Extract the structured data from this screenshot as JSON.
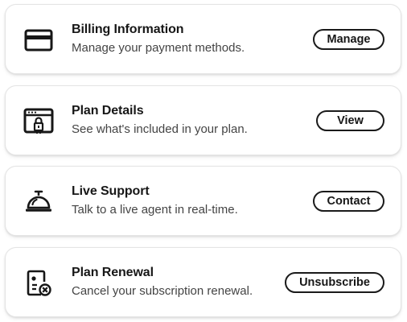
{
  "cards": [
    {
      "icon": "credit-card-icon",
      "title": "Billing Information",
      "subtitle": "Manage your payment methods.",
      "button": "Manage"
    },
    {
      "icon": "browser-lock-icon",
      "title": "Plan Details",
      "subtitle": "See what's included in your plan.",
      "button": "View"
    },
    {
      "icon": "service-bell-icon",
      "title": "Live Support",
      "subtitle": "Talk to a live agent in real-time.",
      "button": "Contact"
    },
    {
      "icon": "document-cancel-icon",
      "title": "Plan Renewal",
      "subtitle": "Cancel your subscription renewal.",
      "button": "Unsubscribe"
    }
  ],
  "colors": {
    "text": "#171717",
    "subtext": "#444444",
    "border": "#1a1a1a",
    "card_border": "#e4e4e4",
    "background": "#ffffff"
  }
}
